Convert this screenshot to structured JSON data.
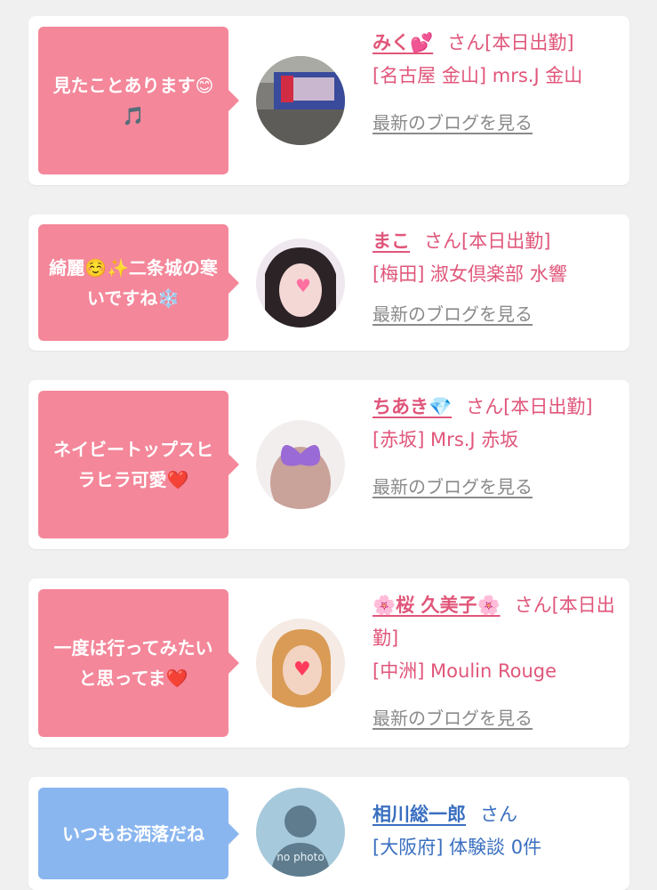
{
  "reviews": [
    {
      "comment": "見たことあります😊🎵",
      "name": "みく💕",
      "san": "さん",
      "status": "[本日出勤]",
      "shop": "[名古屋 金山] mrs.J 金山",
      "blog": "最新のブログを見る",
      "avatar_icon": "avatar-photo-icon"
    },
    {
      "comment": "綺麗☺️✨二条城の寒いですね❄️",
      "name": "まこ",
      "san": "さん",
      "status": "[本日出勤]",
      "shop": "[梅田] 淑女倶楽部 水響",
      "blog": "最新のブログを見る",
      "avatar_icon": "avatar-photo-icon"
    },
    {
      "comment": "ネイビートップスヒラヒラ可愛❤️",
      "name": "ちあき💎",
      "san": "さん",
      "status": "[本日出勤]",
      "shop": "[赤坂] Mrs.J 赤坂",
      "blog": "最新のブログを見る",
      "avatar_icon": "avatar-photo-icon"
    },
    {
      "comment": "一度は行ってみたいと思ってま❤️",
      "name": "🌸桜 久美子🌸",
      "san": "さん",
      "status": "[本日出勤]",
      "shop": "[中洲] Moulin Rouge",
      "blog": "最新のブログを見る",
      "avatar_icon": "avatar-photo-icon"
    },
    {
      "comment": "いつもお洒落だね",
      "name": "相川総一郎",
      "san": "さん",
      "shop": "[大阪府] 体験談 0件",
      "avatar_text": "no photo",
      "avatar_icon": "no-photo-silhouette-icon"
    }
  ],
  "colors": {
    "pink_bubble": "#f4879a",
    "blue_bubble": "#8ab6f0",
    "pink_text": "#e0567a",
    "blue_text": "#3a6fc0",
    "link_gray": "#8a8a8a"
  }
}
